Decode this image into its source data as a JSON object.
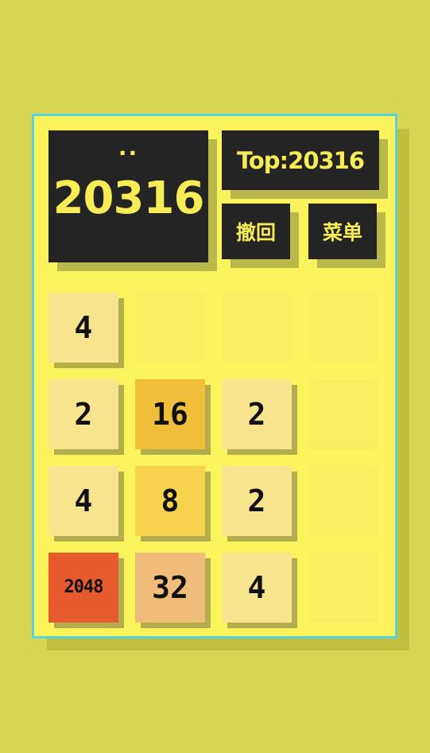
{
  "header": {
    "score_label": "..",
    "score": "20316",
    "top_score": "Top:20316"
  },
  "actions": {
    "undo_label": "撤回",
    "menu_label": "菜单"
  },
  "board": {
    "rows": [
      [
        "4",
        "",
        "",
        ""
      ],
      [
        "2",
        "16",
        "2",
        ""
      ],
      [
        "4",
        "8",
        "2",
        ""
      ],
      [
        "2048",
        "32",
        "4",
        ""
      ]
    ]
  },
  "colors": {
    "background": "#d6d653",
    "board": "#fbf35b",
    "frame": "#5cd0dc",
    "panel": "#242424",
    "panel_text": "#f7ec55",
    "tile_2": "#f8e38f",
    "tile_4": "#f8e38f",
    "tile_8": "#f6d24d",
    "tile_16": "#f0be39",
    "tile_32": "#efbd79",
    "tile_2048": "#e75a2d"
  }
}
